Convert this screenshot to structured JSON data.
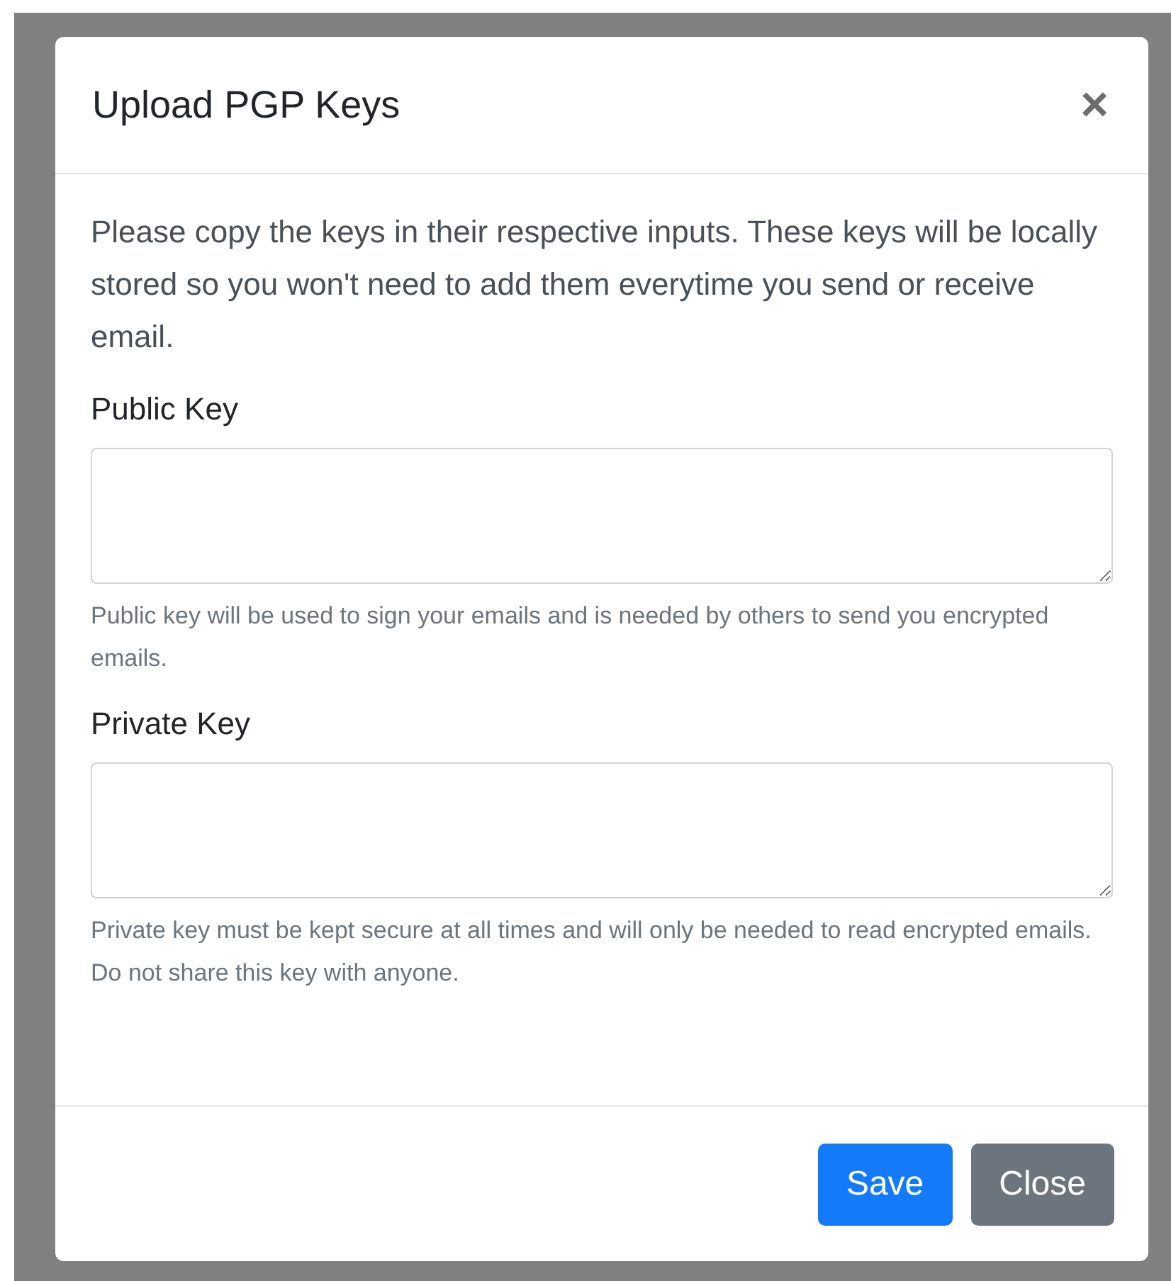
{
  "dialog": {
    "title": "Upload PGP Keys",
    "close_icon": "×"
  },
  "intro": "Please copy the keys in their respective inputs. These keys will be locally stored so you won't need to add them everytime you send or receive email.",
  "fields": [
    {
      "label": "Public Key",
      "help": "Public key will be used to sign your emails and is needed by others to send you encrypted emails."
    },
    {
      "label": "Private Key",
      "help": "Private key must be kept secure at all times and will only be needed to read encrypted emails. Do not share this key with anyone."
    }
  ],
  "buttons": [
    {
      "label": "Save",
      "kind": "primary"
    },
    {
      "label": "Close",
      "kind": "secondary"
    }
  ]
}
